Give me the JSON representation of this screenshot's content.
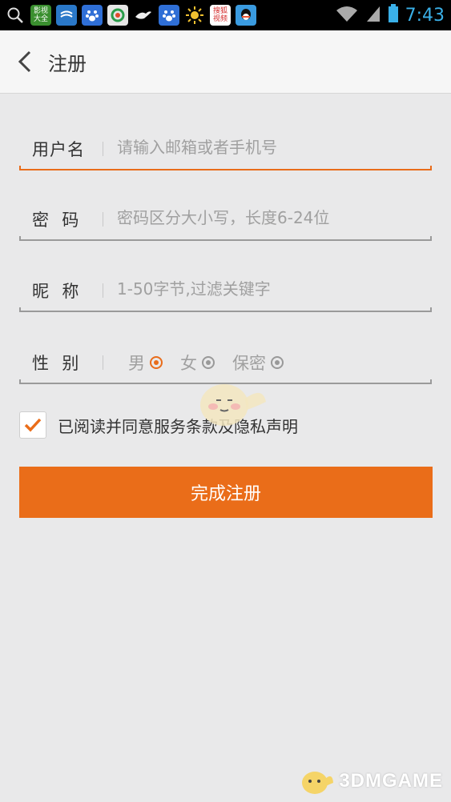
{
  "status_bar": {
    "time": "7:43",
    "icons": [
      {
        "name": "search-icon",
        "color": "#000000"
      },
      {
        "name": "video-app-icon",
        "color": "#3a8f2f",
        "text": "影视大全"
      },
      {
        "name": "wind-app-icon",
        "color": "#2a78c8"
      },
      {
        "name": "baidu-app-icon",
        "color": "#2f6fd6"
      },
      {
        "name": "browser-app-icon",
        "color": "#e6e6e6"
      },
      {
        "name": "bird-app-icon",
        "color": "#000000"
      },
      {
        "name": "baidu-app-icon-2",
        "color": "#2f6fd6"
      },
      {
        "name": "sun-app-icon",
        "color": "#000000"
      },
      {
        "name": "sohu-video-app-icon",
        "color": "#d42b2b",
        "text": "搜狐视频"
      },
      {
        "name": "qq-app-icon",
        "color": "#3a9be0"
      }
    ]
  },
  "header": {
    "title": "注册"
  },
  "form": {
    "username": {
      "label": "用户名",
      "placeholder": "请输入邮箱或者手机号"
    },
    "password": {
      "label": "密  码",
      "placeholder": "密码区分大小写，长度6-24位"
    },
    "nickname": {
      "label": "昵  称",
      "placeholder": "1-50字节,过滤关键字"
    },
    "gender": {
      "label": "性  别",
      "options": [
        {
          "label": "男",
          "selected": true
        },
        {
          "label": "女",
          "selected": false
        },
        {
          "label": "保密",
          "selected": false
        }
      ]
    }
  },
  "agreement": {
    "text": "已阅读并同意服务条款及隐私声明",
    "checked": true
  },
  "submit_label": "完成注册",
  "watermark": {
    "brand": "3DMGAME"
  },
  "colors": {
    "accent": "#ea6d19",
    "background": "#e9e9ea"
  }
}
